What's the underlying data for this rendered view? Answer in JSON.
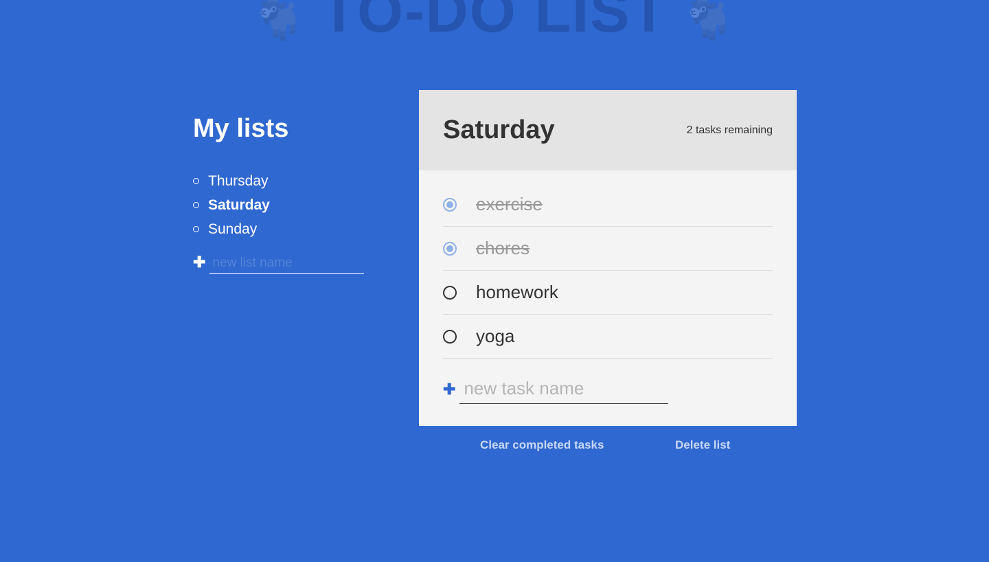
{
  "app": {
    "title": "TO-DO LIST",
    "logo_icon": "goat-icon"
  },
  "sidebar": {
    "title": "My lists",
    "lists": [
      {
        "label": "Thursday",
        "active": false
      },
      {
        "label": "Saturday",
        "active": true
      },
      {
        "label": "Sunday",
        "active": false
      }
    ],
    "new_list_placeholder": "new list name",
    "new_list_value": ""
  },
  "list": {
    "title": "Saturday",
    "remaining": "2 tasks remaining",
    "tasks": [
      {
        "label": "exercise",
        "completed": true
      },
      {
        "label": "chores",
        "completed": true
      },
      {
        "label": "homework",
        "completed": false
      },
      {
        "label": "yoga",
        "completed": false
      }
    ],
    "new_task_placeholder": "new task name",
    "new_task_value": ""
  },
  "actions": {
    "clear_completed": "Clear completed tasks",
    "delete_list": "Delete list"
  },
  "colors": {
    "background": "#2f68d0",
    "card": "#f4f4f4",
    "card_header": "#e4e4e4",
    "completed_check": "#8fb0e8",
    "action_text": "#c7d7f4"
  }
}
